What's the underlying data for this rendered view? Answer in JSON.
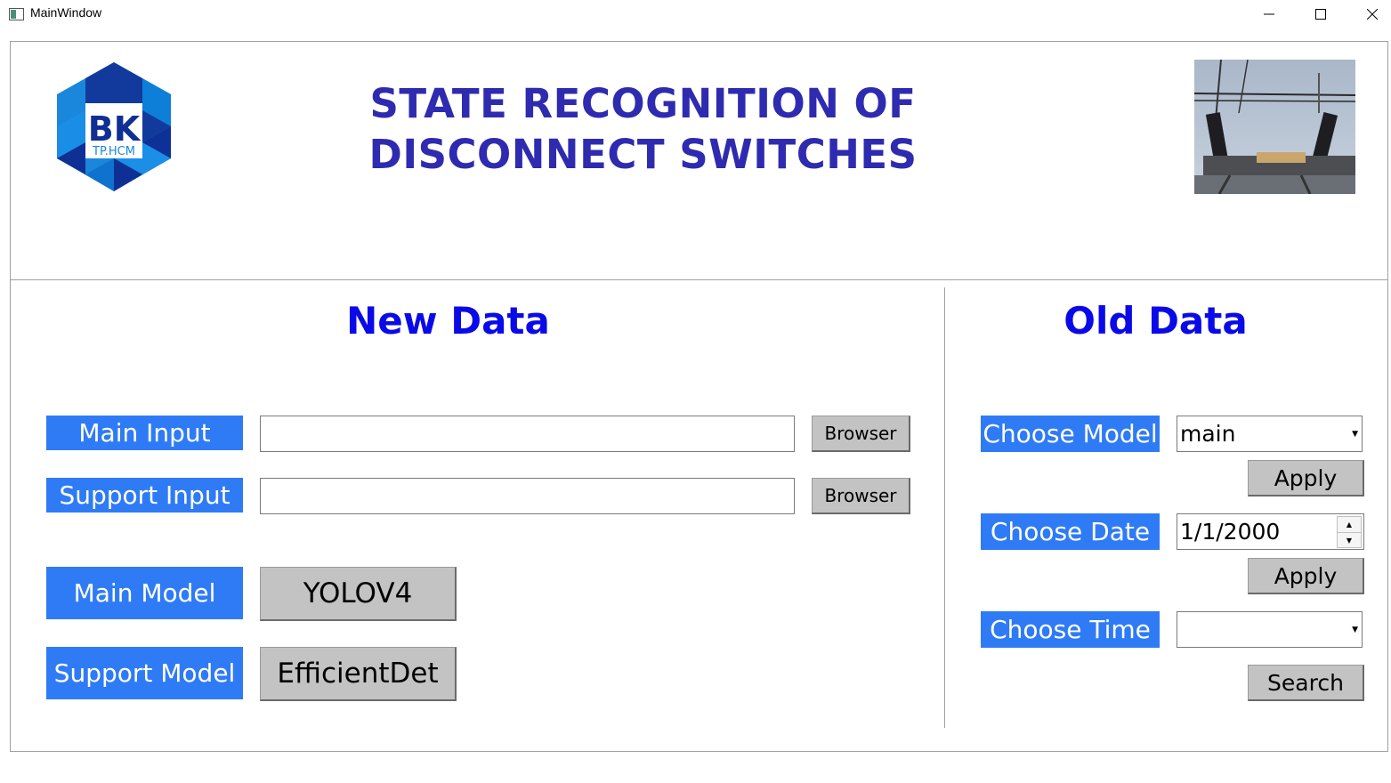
{
  "window": {
    "title": "MainWindow"
  },
  "header": {
    "title": "STATE RECOGNITION OF\nDISCONNECT SWITCHES",
    "logo": {
      "letters": "BK",
      "subtitle": "TP.HCM"
    }
  },
  "new_data": {
    "title": "New Data",
    "main_input_label": "Main Input",
    "main_input_value": "",
    "support_input_label": "Support Input",
    "support_input_value": "",
    "browse_label": "Browser",
    "main_model_label": "Main Model",
    "main_model_value": "YOLOV4",
    "support_model_label": "Support Model",
    "support_model_value": "EfficientDet"
  },
  "old_data": {
    "title": "Old Data",
    "choose_model_label": "Choose Model",
    "model_selected": "main",
    "apply_label": "Apply",
    "choose_date_label": "Choose Date",
    "date_value": "1/1/2000",
    "choose_time_label": "Choose Time",
    "time_selected": "",
    "search_label": "Search"
  },
  "colors": {
    "label_bg": "#2f7bf5",
    "title_blue": "#2e2bb0",
    "section_blue": "#0a0ae8",
    "button_gray": "#c3c3c3"
  }
}
